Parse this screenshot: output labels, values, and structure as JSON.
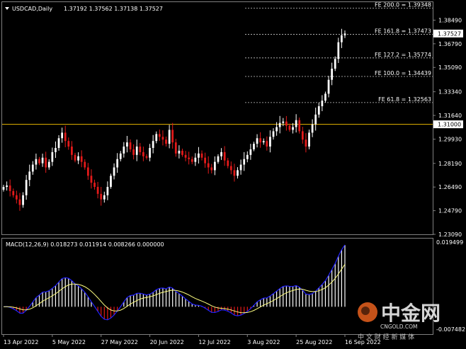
{
  "header": {
    "symbol": "USDCAD,Daily",
    "ohlc": "1.37192 1.37562 1.37138 1.37527"
  },
  "macd": {
    "label": "MACD(12,26,9) 0.018273 0.011914 0.008266 0.000000",
    "axis_top": "0.019499",
    "axis_bottom": "-0.007482"
  },
  "colors": {
    "background": "#000000",
    "bull": "#ffffff",
    "bear": "#e41a1a",
    "fib": "#c8c8c8",
    "level": "#e6b400",
    "macd_line": "#2323ff",
    "signal_line": "#ffff80"
  },
  "watermark": {
    "brand": "中金网",
    "domain": "CNGOLD.COM",
    "tagline": "中 文 财 经 新 媒 体"
  },
  "chart_data": [
    {
      "type": "candlestick",
      "title": "USDCAD,Daily",
      "ylim": [
        1.2309,
        1.3948
      ],
      "y_ticks": [
        "1.38490",
        "1.36790",
        "1.35090",
        "1.33340",
        "1.31640",
        "1.29930",
        "1.28190",
        "1.26490",
        "1.24790",
        "1.23090"
      ],
      "x_ticks": [
        "13 Apr 2022",
        "5 May 2022",
        "27 May 2022",
        "20 Jun 2022",
        "12 Jul 2022",
        "3 Aug 2022",
        "25 Aug 2022",
        "16 Sep 2022"
      ],
      "current_price": "1.37527",
      "horizontal_level": "1.31000",
      "fibonacci_levels": [
        {
          "label": "FE 200.0 = 1.39348",
          "value": 1.39348
        },
        {
          "label": "FE 161.8 = 1.37473",
          "value": 1.37473
        },
        {
          "label": "FE 127.2 = 1.35774",
          "value": 1.35774
        },
        {
          "label": "FE 100.0 = 1.34439",
          "value": 1.34439
        },
        {
          "label": "FE 61.8 = 1.32563",
          "value": 1.32563
        }
      ],
      "close": [
        1.265,
        1.266,
        1.262,
        1.259,
        1.256,
        1.252,
        1.259,
        1.27,
        1.276,
        1.281,
        1.285,
        1.282,
        1.286,
        1.279,
        1.283,
        1.29,
        1.293,
        1.3,
        1.304,
        1.298,
        1.294,
        1.288,
        1.284,
        1.287,
        1.283,
        1.279,
        1.273,
        1.268,
        1.265,
        1.26,
        1.256,
        1.259,
        1.265,
        1.273,
        1.279,
        1.285,
        1.289,
        1.294,
        1.297,
        1.292,
        1.288,
        1.294,
        1.29,
        1.287,
        1.286,
        1.293,
        1.298,
        1.303,
        1.301,
        1.299,
        1.296,
        1.306,
        1.297,
        1.289,
        1.291,
        1.288,
        1.286,
        1.285,
        1.283,
        1.286,
        1.289,
        1.286,
        1.282,
        1.279,
        1.277,
        1.283,
        1.287,
        1.29,
        1.284,
        1.28,
        1.277,
        1.273,
        1.277,
        1.281,
        1.285,
        1.288,
        1.292,
        1.296,
        1.3,
        1.297,
        1.298,
        1.294,
        1.301,
        1.305,
        1.308,
        1.311,
        1.312,
        1.309,
        1.306,
        1.308,
        1.313,
        1.305,
        1.299,
        1.294,
        1.304,
        1.31,
        1.317,
        1.323,
        1.327,
        1.332,
        1.342,
        1.35,
        1.357,
        1.369,
        1.374,
        1.3753
      ]
    },
    {
      "type": "macd",
      "title": "MACD(12,26,9)",
      "ylim": [
        -0.007482,
        0.019499
      ],
      "macd_value": 0.018273,
      "signal_value": 0.011914,
      "histogram_value": 0.008266,
      "level": 0.0
    }
  ]
}
